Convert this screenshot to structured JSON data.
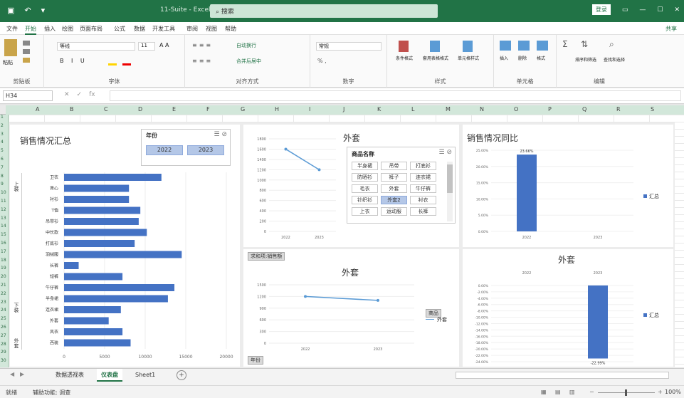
{
  "window": {
    "title": "11-Suite - Excel",
    "search_placeholder": "搜索",
    "login_label": "登录",
    "accent": "#217346"
  },
  "menu": [
    "文件",
    "开始",
    "插入",
    "绘图",
    "页面布局",
    "公式",
    "数据",
    "开发工具",
    "审阅",
    "视图",
    "帮助"
  ],
  "menu_share": "共享",
  "ribbon": {
    "groups": [
      "剪贴板",
      "字体",
      "对齐方式",
      "数字",
      "样式",
      "单元格",
      "编辑"
    ],
    "buttons": {
      "paste": "粘贴",
      "font_name": "等线",
      "font_size": "11",
      "wrap": "自动换行",
      "merge": "合并后居中",
      "number_format": "常规",
      "cond_format": "条件格式",
      "table_format": "套用表格格式",
      "cell_style": "单元格样式",
      "insert": "插入",
      "delete": "删除",
      "format": "格式",
      "sort_filter": "排序和筛选",
      "find_select": "查找和选择"
    }
  },
  "formula_bar": {
    "name_box": "H34",
    "fx": "fx",
    "value": ""
  },
  "columns": [
    "A",
    "B",
    "C",
    "D",
    "E",
    "F",
    "G",
    "H",
    "I",
    "J",
    "K",
    "L",
    "M",
    "N",
    "O",
    "P",
    "Q",
    "R",
    "S"
  ],
  "rows": [
    "1",
    "2",
    "3",
    "4",
    "5",
    "6",
    "7",
    "8",
    "9",
    "10",
    "11",
    "12",
    "13",
    "14",
    "15",
    "16",
    "17",
    "18",
    "19",
    "20",
    "21",
    "22",
    "23",
    "24",
    "25",
    "26",
    "27",
    "28",
    "29",
    "30"
  ],
  "dashboard": {
    "summary": {
      "title": "销售情况汇总",
      "slicer": {
        "header": "年份",
        "items": [
          "2022",
          "2023"
        ]
      },
      "groups": [
        "上装",
        "下装",
        "外套"
      ],
      "chart_data": {
        "type": "bar",
        "orientation": "horizontal",
        "categories": [
          "卫衣",
          "背心",
          "衬衫",
          "T恤",
          "吊带衫",
          "中长款",
          "打底衫",
          "羽绒服",
          "长裤",
          "短裤",
          "牛仔裤",
          "半身裙",
          "连衣裙",
          "外套",
          "风衣",
          "西装"
        ],
        "values": [
          12000,
          8000,
          8000,
          9400,
          9200,
          10200,
          8700,
          14500,
          1800,
          7200,
          13600,
          12800,
          7000,
          5500,
          7200,
          8200
        ],
        "xticks": [
          "0",
          "5000",
          "10000",
          "15000",
          "20000"
        ],
        "xlim": [
          0,
          20000
        ]
      }
    },
    "line_top": {
      "title": "外套",
      "chart_data": {
        "type": "line",
        "x": [
          "2022",
          "2023"
        ],
        "values": [
          1600,
          1200
        ],
        "yticks": [
          "0",
          "200",
          "400",
          "600",
          "800",
          "1000",
          "1200",
          "1400",
          "1600",
          "1800"
        ],
        "ylim": [
          0,
          1800
        ]
      },
      "slicer": {
        "header": "商品名称",
        "items": [
          "半身裙",
          "吊带",
          "打底衫",
          "防晒衫",
          "裤子",
          "连衣裙",
          "毛衣",
          "外套",
          "牛仔裤",
          "针织衫",
          "外套2",
          "衬衣",
          "上衣",
          "运动服",
          "长裤"
        ]
      }
    },
    "line_bottom": {
      "field_button": "求和项:销售额",
      "title": "外套",
      "chart_data": {
        "type": "line",
        "x": [
          "2022",
          "2023"
        ],
        "series": [
          {
            "name": "外套",
            "values": [
              1200,
              1100
            ]
          }
        ],
        "yticks": [
          "0",
          "300",
          "600",
          "900",
          "1200",
          "1500"
        ],
        "ylim": [
          0,
          1500
        ]
      },
      "legend_button": "商品",
      "legend_item": "外套",
      "axis_button": "年份"
    },
    "yoy_top": {
      "title": "销售情况同比",
      "chart_data": {
        "type": "bar",
        "categories": [
          "2022",
          "2023"
        ],
        "values": [
          23.66,
          0
        ],
        "data_labels": [
          "23.66%",
          ""
        ],
        "yticks": [
          "0.00%",
          "5.00%",
          "10.00%",
          "15.00%",
          "20.00%",
          "25.00%"
        ],
        "ylim": [
          0,
          25
        ]
      },
      "legend": "汇总"
    },
    "yoy_bottom": {
      "title": "外套",
      "chart_data": {
        "type": "bar",
        "categories": [
          "2022",
          "2023"
        ],
        "values": [
          0,
          -22.99
        ],
        "data_labels": [
          "",
          "-22.99%"
        ],
        "yticks": [
          "0.00%",
          "-2.00%",
          "-4.00%",
          "-6.00%",
          "-8.00%",
          "-10.00%",
          "-12.00%",
          "-14.00%",
          "-16.00%",
          "-18.00%",
          "-20.00%",
          "-22.00%",
          "-24.00%"
        ],
        "ylim": [
          -24,
          2
        ]
      },
      "legend": "汇总"
    }
  },
  "sheet_tabs": [
    "数据透视表",
    "仪表盘",
    "Sheet1"
  ],
  "active_tab": "仪表盘",
  "add_sheet": "+",
  "status": {
    "ready": "就绪",
    "accessibility": "辅助功能: 调查",
    "zoom": "100%"
  }
}
